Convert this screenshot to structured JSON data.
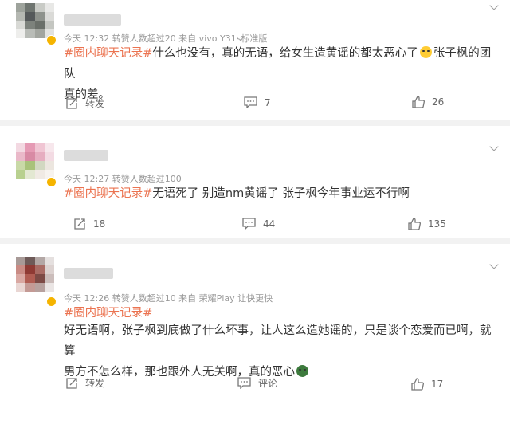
{
  "posts": [
    {
      "meta": "今天 12:32 转赞人数超过20  来自 vivo Y31s标准版",
      "hashtag": "#圈内聊天记录#",
      "text_a": "什么也没有，真的无语，给女生造黄谣的都太恶心了",
      "text_b": "张子枫的团队",
      "text_c": "真的差。",
      "repost_label": "转发",
      "comment_count": "7",
      "like_count": "26"
    },
    {
      "meta": "今天 12:27 转赞人数超过100",
      "hashtag": "#圈内聊天记录#",
      "text_a": "无语死了 别造nm黄谣了 张子枫今年事业运不行啊",
      "repost_count": "18",
      "comment_count": "44",
      "like_count": "135"
    },
    {
      "meta": "今天 12:26 转赞人数超过10  来自 荣耀Play 让快更快",
      "hashtag": "#圈内聊天记录#",
      "text_a": "好无语啊，张子枫到底做了什么坏事，让人这么造她谣的，只是谈个恋爱而已啊，就算",
      "text_b": "男方不怎么样，那也跟外人无关啊，真的恶心",
      "repost_label": "转发",
      "comment_label": "评论",
      "like_count": "17"
    }
  ],
  "icons": {
    "more": "chevron-down-icon",
    "repost": "repost-icon",
    "comment": "comment-icon",
    "like": "thumbs-up-icon"
  },
  "colors": {
    "hashtag": "#eb7350",
    "meta": "#999999",
    "badge": "#f5b400"
  }
}
